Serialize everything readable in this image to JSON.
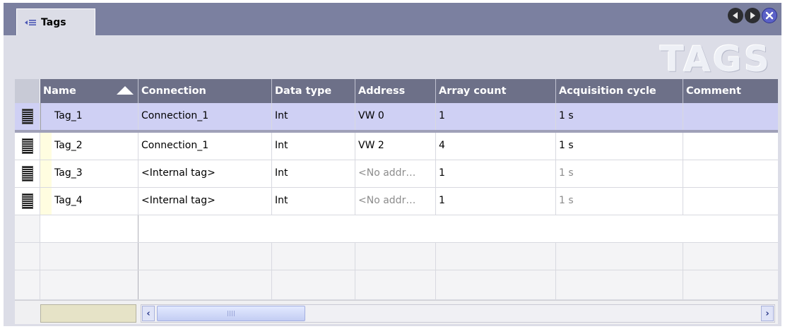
{
  "window": {
    "tab_label": "Tags",
    "big_title": "TAGS",
    "nav": {
      "prev": "previous",
      "next": "next",
      "close": "close"
    }
  },
  "columns": [
    {
      "key": "name",
      "label": "Name"
    },
    {
      "key": "connection",
      "label": "Connection"
    },
    {
      "key": "data_type",
      "label": "Data type"
    },
    {
      "key": "address",
      "label": "Address"
    },
    {
      "key": "array_count",
      "label": "Array count"
    },
    {
      "key": "acquisition_cycle",
      "label": "Acquisition cycle"
    },
    {
      "key": "comment",
      "label": "Comment"
    }
  ],
  "rows": [
    {
      "name": "Tag_1",
      "connection": "Connection_1",
      "data_type": "Int",
      "address": "VW 0",
      "array_count": "1",
      "acquisition_cycle": "1 s",
      "comment": ""
    },
    {
      "name": "Tag_2",
      "connection": "Connection_1",
      "data_type": "Int",
      "address": "VW 2",
      "array_count": "4",
      "acquisition_cycle": "1 s",
      "comment": ""
    },
    {
      "name": "Tag_3",
      "connection": "<Internal tag>",
      "data_type": "Int",
      "address": "<No addr…",
      "array_count": "1",
      "acquisition_cycle": "1 s",
      "comment": ""
    },
    {
      "name": "Tag_4",
      "connection": "<Internal tag>",
      "data_type": "Int",
      "address": "<No addr…",
      "array_count": "1",
      "acquisition_cycle": "1 s",
      "comment": ""
    }
  ],
  "colors": {
    "tab_strip": "#7b80a0",
    "header_bg": "#6d7088",
    "selected_row": "#cfd0f4",
    "window_bg": "#dcdde7"
  },
  "scrollbar": {
    "left_arrow": "‹",
    "right_arrow": "›"
  }
}
